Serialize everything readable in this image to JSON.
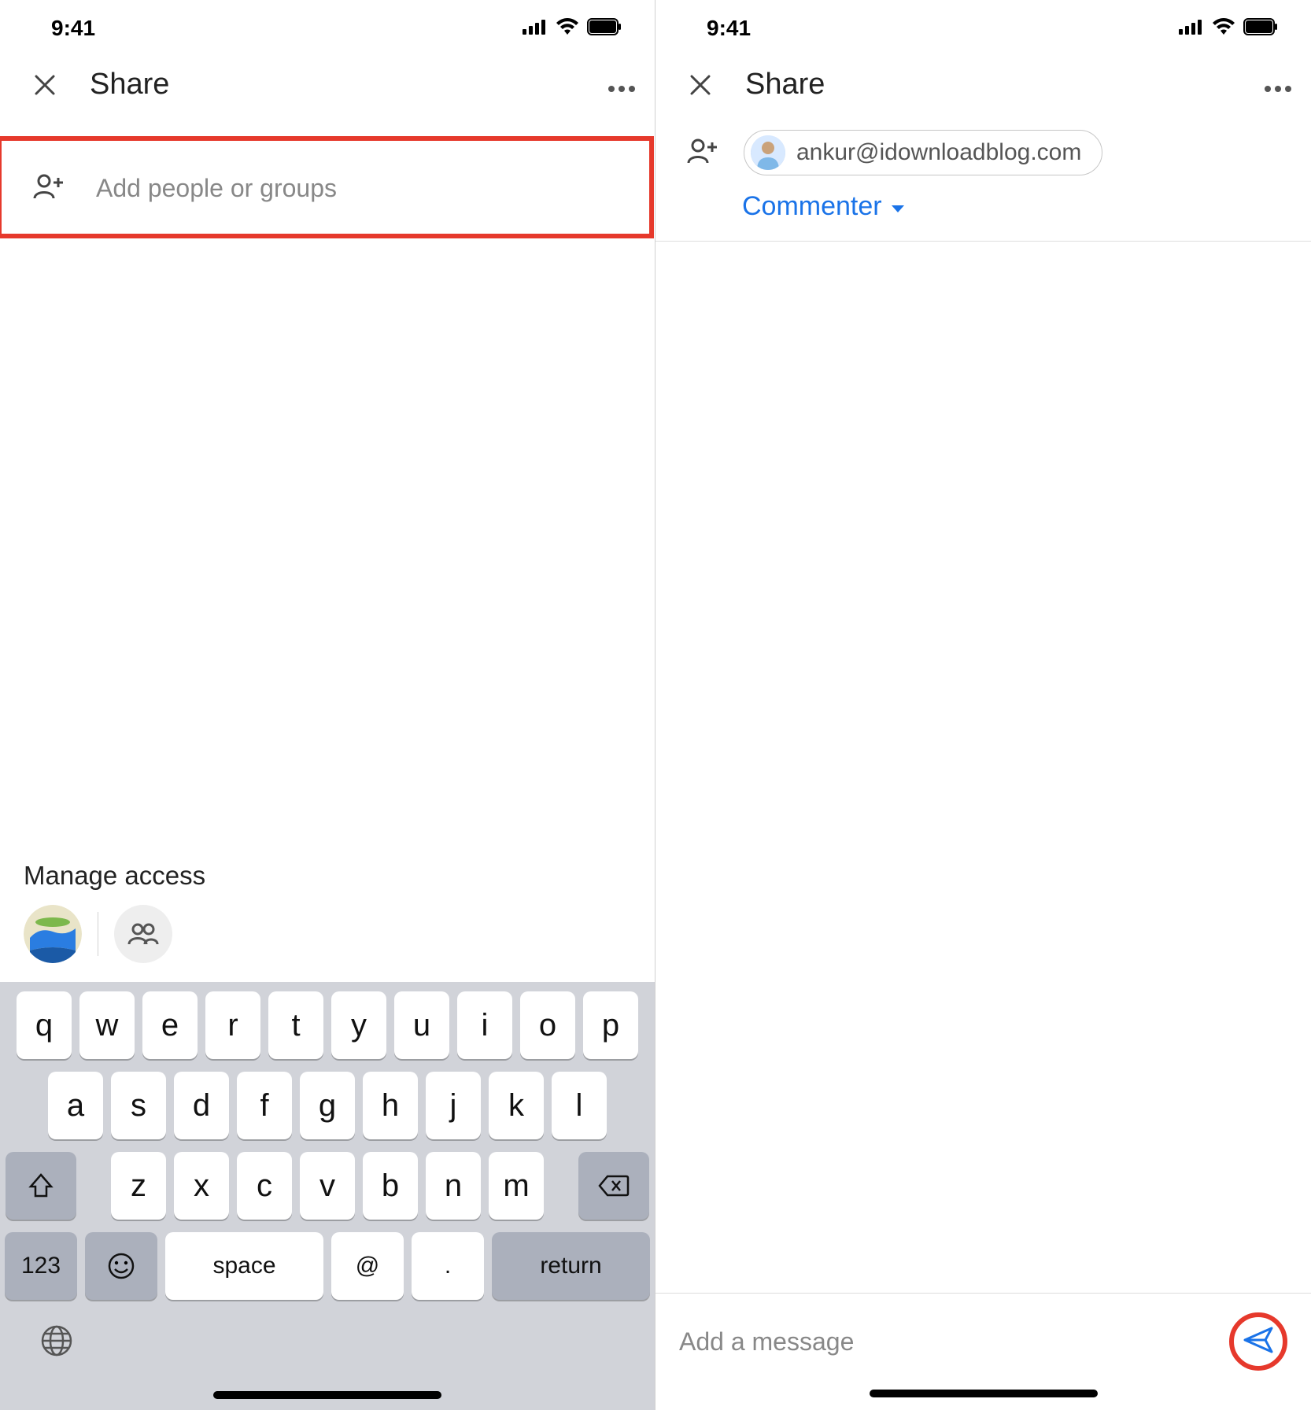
{
  "statusbar": {
    "time": "9:41"
  },
  "header": {
    "title": "Share"
  },
  "left": {
    "add_placeholder": "Add people or groups",
    "manage_title": "Manage access"
  },
  "right": {
    "chip_email": "ankur@idownloadblog.com",
    "role_label": "Commenter",
    "msg_placeholder": "Add a message"
  },
  "keyboard": {
    "row1": [
      "q",
      "w",
      "e",
      "r",
      "t",
      "y",
      "u",
      "i",
      "o",
      "p"
    ],
    "row2": [
      "a",
      "s",
      "d",
      "f",
      "g",
      "h",
      "j",
      "k",
      "l"
    ],
    "row3": [
      "z",
      "x",
      "c",
      "v",
      "b",
      "n",
      "m"
    ],
    "fn123": "123",
    "space": "space",
    "at": "@",
    "dot": ".",
    "return": "return"
  }
}
